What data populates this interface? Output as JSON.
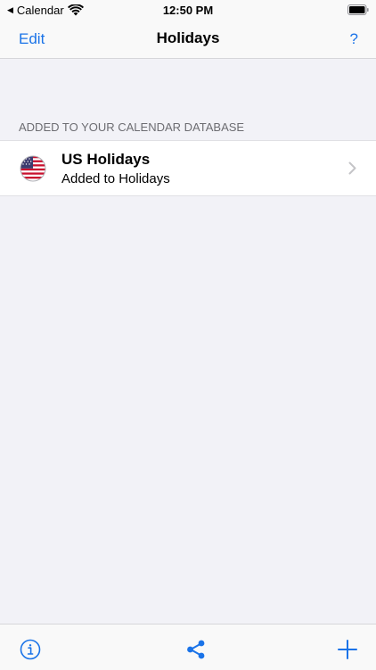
{
  "status_bar": {
    "back_app": "Calendar",
    "time": "12:50 PM"
  },
  "nav": {
    "left_label": "Edit",
    "title": "Holidays",
    "right_label": "?"
  },
  "section": {
    "header": "ADDED TO YOUR CALENDAR DATABASE",
    "items": [
      {
        "title": "US Holidays",
        "subtitle": "Added to Holidays",
        "icon": "us-flag-icon"
      }
    ]
  },
  "toolbar": {
    "icons": [
      "info-icon",
      "share-icon",
      "add-icon"
    ]
  },
  "colors": {
    "accent": "#1a73e8",
    "background": "#f2f2f7",
    "cell": "#ffffff",
    "secondary_text": "#6d6d72"
  }
}
